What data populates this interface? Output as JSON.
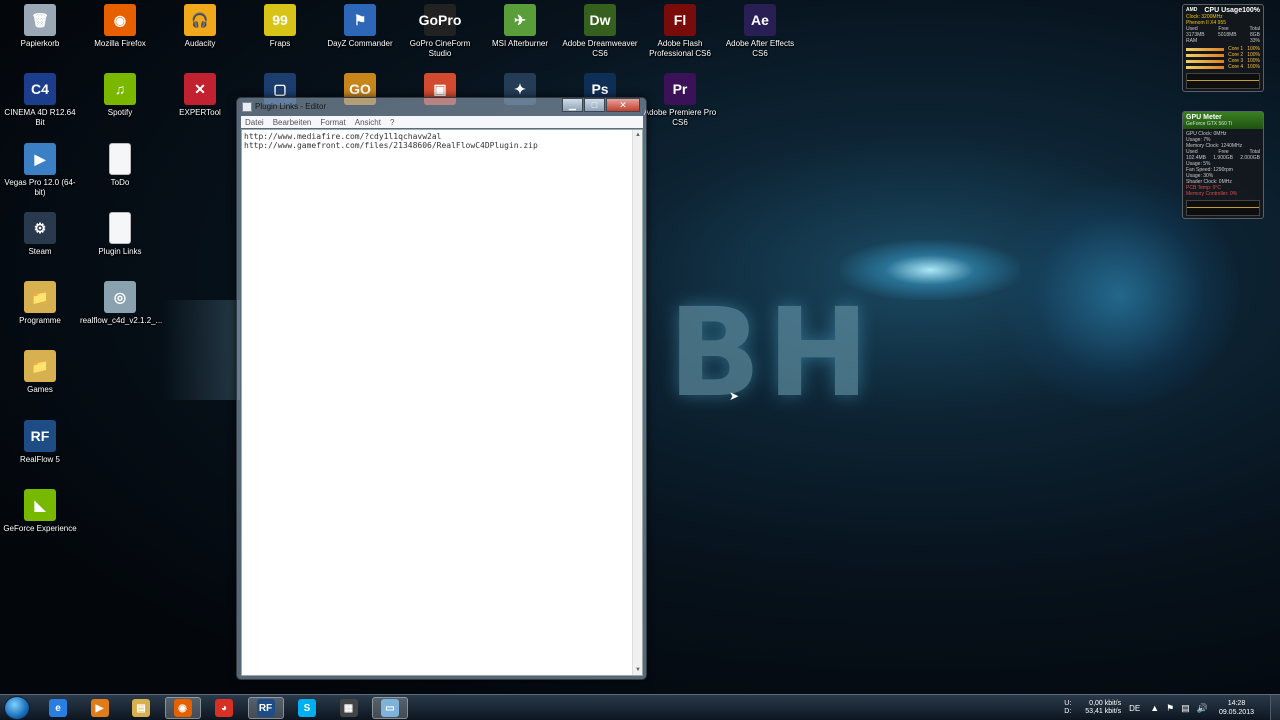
{
  "desktop": {
    "icons": [
      {
        "label": "Papierkorb",
        "glyph": "🗑",
        "color": "#9aa7b4"
      },
      {
        "label": "Mozilla Firefox",
        "glyph": "◉",
        "color": "#e66000"
      },
      {
        "label": "Audacity",
        "glyph": "🎧",
        "color": "#f1a81b"
      },
      {
        "label": "Fraps",
        "glyph": "99",
        "color": "#d8c418"
      },
      {
        "label": "DayZ Commander",
        "glyph": "⚑",
        "color": "#2f67b8"
      },
      {
        "label": "GoPro CineForm Studio",
        "glyph": "GoPro",
        "color": "#222222"
      },
      {
        "label": "MSI Afterburner",
        "glyph": "✈",
        "color": "#5a9e3a"
      },
      {
        "label": "Adobe Dreamweaver CS6",
        "glyph": "Dw",
        "color": "#35601d"
      },
      {
        "label": "Adobe Flash Professional CS6",
        "glyph": "Fl",
        "color": "#7a0b0b"
      },
      {
        "label": "Adobe After Effects CS6",
        "glyph": "Ae",
        "color": "#2a1f55"
      },
      {
        "label": "CINEMA 4D R12.64 Bit",
        "glyph": "C4",
        "color": "#1b3d8c"
      },
      {
        "label": "Spotify",
        "glyph": "♫",
        "color": "#7ab800"
      },
      {
        "label": "EXPERTool",
        "glyph": "✕",
        "color": "#c2212f"
      },
      {
        "label": "Vegas Pro 12.0 (64-bit)",
        "glyph": "▶",
        "color": "#3b7fc4"
      },
      {
        "label": "ToDo",
        "glyph": "",
        "color": "#f4f6f8"
      },
      {
        "label": "Steam",
        "glyph": "⚙",
        "color": "#2a3a4e"
      },
      {
        "label": "Plugin Links",
        "glyph": "",
        "color": "#f4f6f8"
      },
      {
        "label": "Programme",
        "glyph": "📁",
        "color": "#d7b04f"
      },
      {
        "label": "realflow_c4d_v2.1.2_...",
        "glyph": "◎",
        "color": "#8aa2b0"
      },
      {
        "label": "Games",
        "glyph": "📁",
        "color": "#d7b04f"
      },
      {
        "label": "RealFlow 5",
        "glyph": "RF",
        "color": "#1e4d86"
      },
      {
        "label": "GeForce Experience",
        "glyph": "◣",
        "color": "#76b900"
      },
      {
        "label": "Adobe Premiere Pro CS6",
        "glyph": "Pr",
        "color": "#3b1258"
      },
      {
        "label": "",
        "glyph": "Ps",
        "color": "#0f2e56"
      },
      {
        "label": "",
        "glyph": "GO",
        "color": "#c8851c"
      },
      {
        "label": "",
        "glyph": "▣",
        "color": "#d24b2f"
      },
      {
        "label": "",
        "glyph": "▢",
        "color": "#1c3e6e"
      },
      {
        "label": "",
        "glyph": "✦",
        "color": "#243c55"
      }
    ],
    "bg_logo_text": "BH"
  },
  "notepad": {
    "title": "Plugin Links - Editor",
    "menu": [
      "Datei",
      "Bearbeiten",
      "Format",
      "Ansicht",
      "?"
    ],
    "lines": [
      "http://www.mediafire.com/?cdy1l1qchavw2al",
      "http://www.gamefront.com/files/21348606/RealFlowC4DPlugin.zip"
    ],
    "buttons": {
      "minimize": "▁",
      "maximize": "□",
      "close": "✕"
    }
  },
  "gadgets": {
    "cpu": {
      "title": "CPU Usage100%",
      "brand": "AMD",
      "clock": "Clock: 3200MHz",
      "model": "Phenom II X4 955",
      "mem_header": [
        "Used",
        "Free",
        "Total"
      ],
      "mem_values": [
        "3173MB",
        "5018MB",
        "8GB"
      ],
      "ram_label": "RAM",
      "ram_pct": "33%",
      "cores": [
        {
          "name": "Core 1",
          "pct": "100%",
          "level": 1.0
        },
        {
          "name": "Core 2",
          "pct": "100%",
          "level": 1.0
        },
        {
          "name": "Core 3",
          "pct": "100%",
          "level": 1.0
        },
        {
          "name": "Core 4",
          "pct": "100%",
          "level": 1.0
        }
      ]
    },
    "gpu": {
      "title": "GPU Meter",
      "model": "GeForce GTX 560 Ti",
      "rows": [
        [
          "GPU Clock: 0MHz",
          ""
        ],
        [
          "Usage: 7%",
          ""
        ],
        [
          "Memory Clock: 1240MHz",
          ""
        ],
        [
          "Used",
          "Free",
          "Total"
        ],
        [
          "102.4MB",
          "1.900GB",
          "2.000GB"
        ],
        [
          "Usage: 5%",
          ""
        ],
        [
          "Fan Speed: 1290rpm",
          ""
        ],
        [
          "Usage: 30%",
          ""
        ],
        [
          "Shader Clock: 0MHz",
          ""
        ],
        [
          "PCB Temp: 0°C",
          ""
        ],
        [
          "Memory Controller: 0%",
          ""
        ]
      ]
    }
  },
  "taskbar": {
    "apps": [
      {
        "name": "internet-explorer",
        "glyph": "e",
        "color": "#2a7de1",
        "active": false
      },
      {
        "name": "media-player",
        "glyph": "▶",
        "color": "#e07b1a",
        "active": false
      },
      {
        "name": "explorer",
        "glyph": "▤",
        "color": "#d7b04f",
        "active": false
      },
      {
        "name": "firefox",
        "glyph": "◉",
        "color": "#e66000",
        "active": true
      },
      {
        "name": "chrome",
        "glyph": "◕",
        "color": "#d93025",
        "active": false
      },
      {
        "name": "realflow",
        "glyph": "RF",
        "color": "#1e4d86",
        "active": true
      },
      {
        "name": "skype",
        "glyph": "S",
        "color": "#00aff0",
        "active": false
      },
      {
        "name": "unknown-app",
        "glyph": "▦",
        "color": "#444444",
        "active": false
      },
      {
        "name": "notepad",
        "glyph": "▭",
        "color": "#7fb2d8",
        "active": true
      }
    ],
    "net_up_label": "U:",
    "net_down_label": "D:",
    "net_up": "0,00 kbit/s",
    "net_down": "53,41 kbit/s",
    "language": "DE",
    "time": "14:28",
    "date": "09.05.2013"
  }
}
